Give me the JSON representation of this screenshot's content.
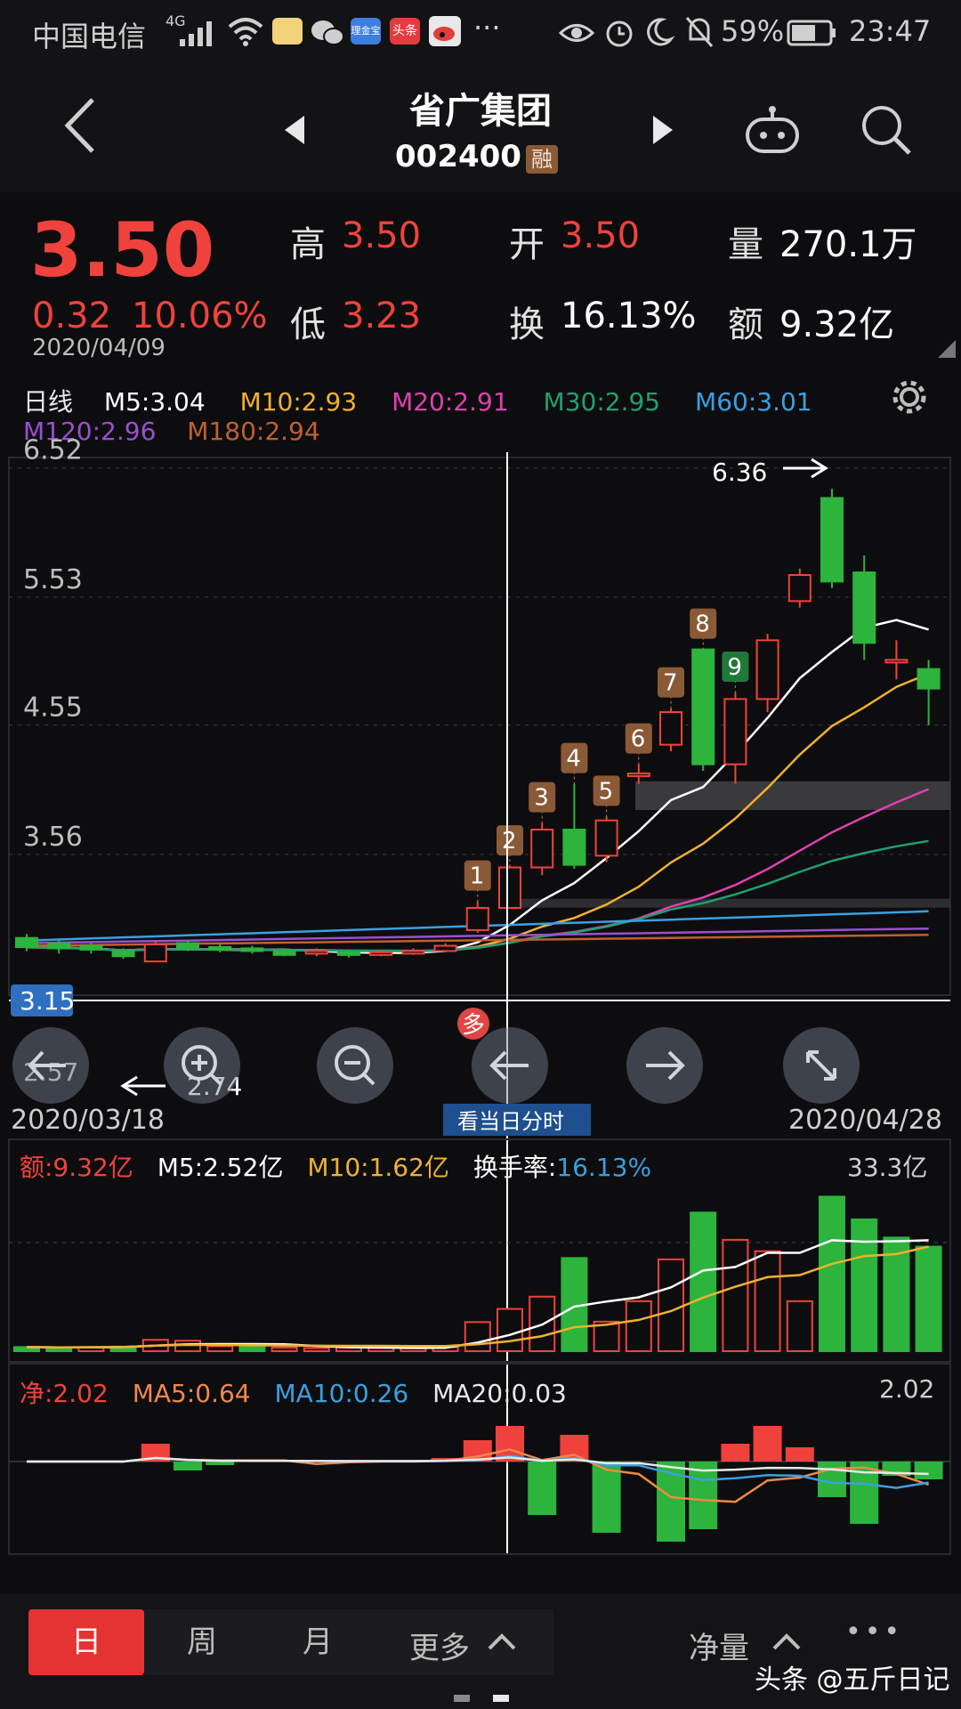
{
  "status_bar": {
    "carrier": "中国电信",
    "signal": "4G",
    "battery": "59%",
    "time": "23:47",
    "app_icons": [
      "game-app-icon",
      "wechat-icon",
      "jinyinbao-app-icon",
      "toutiao-app-icon",
      "weibo-icon"
    ],
    "app_icon_labels": [
      "",
      "",
      "理金宝",
      "头条",
      ""
    ],
    "more": "···"
  },
  "header": {
    "stock_name": "省广集团",
    "stock_code": "002400",
    "margin_badge": "融"
  },
  "quote": {
    "price": "3.50",
    "change": "0.32",
    "change_pct": "10.06%",
    "date": "2020/04/09",
    "high_label": "高",
    "high": "3.50",
    "low_label": "低",
    "low": "3.23",
    "open_label": "开",
    "open": "3.50",
    "turnover_label": "换",
    "turnover": "16.13%",
    "volume_label": "量",
    "volume": "270.1万",
    "amount_label": "额",
    "amount": "9.32亿"
  },
  "ma_legend": {
    "period": "日线",
    "m5": "M5:3.04",
    "m10": "M10:2.93",
    "m20": "M20:2.91",
    "m30": "M30:2.95",
    "m60": "M60:3.01",
    "m120": "M120:2.96",
    "m180": "M180:2.94",
    "colors": {
      "m5": "#ffffff",
      "m10": "#f0b030",
      "m20": "#e040b0",
      "m30": "#20a070",
      "m60": "#3aa0e0",
      "m120": "#9a50d0",
      "m180": "#c06030"
    }
  },
  "chart_data": {
    "type": "candlestick",
    "y_ticks": [
      "6.52",
      "5.53",
      "4.55",
      "3.56"
    ],
    "ylim": [
      2.55,
      6.6
    ],
    "crosshair_value": "3.15",
    "max_annotation": "6.36",
    "min_annotation": "2.74",
    "left_edge_value": "2.57",
    "start_date": "2020/03/18",
    "end_date": "2020/04/28",
    "view_intraday_label": "看当日分时",
    "signal_marker": "多",
    "count_labels": [
      "1",
      "2",
      "3",
      "4",
      "5",
      "6",
      "7",
      "8",
      "9"
    ],
    "candles": [
      {
        "o": 2.92,
        "c": 2.85,
        "h": 2.95,
        "l": 2.82
      },
      {
        "o": 2.88,
        "c": 2.84,
        "h": 2.9,
        "l": 2.8
      },
      {
        "o": 2.86,
        "c": 2.83,
        "h": 2.88,
        "l": 2.8
      },
      {
        "o": 2.82,
        "c": 2.78,
        "h": 2.84,
        "l": 2.76
      },
      {
        "o": 2.74,
        "c": 2.87,
        "h": 2.9,
        "l": 2.74
      },
      {
        "o": 2.88,
        "c": 2.84,
        "h": 2.9,
        "l": 2.82
      },
      {
        "o": 2.85,
        "c": 2.83,
        "h": 2.87,
        "l": 2.81
      },
      {
        "o": 2.84,
        "c": 2.82,
        "h": 2.86,
        "l": 2.8
      },
      {
        "o": 2.82,
        "c": 2.79,
        "h": 2.84,
        "l": 2.78
      },
      {
        "o": 2.8,
        "c": 2.82,
        "h": 2.84,
        "l": 2.78
      },
      {
        "o": 2.81,
        "c": 2.79,
        "h": 2.83,
        "l": 2.77
      },
      {
        "o": 2.79,
        "c": 2.81,
        "h": 2.83,
        "l": 2.78
      },
      {
        "o": 2.8,
        "c": 2.82,
        "h": 2.84,
        "l": 2.79
      },
      {
        "o": 2.82,
        "c": 2.86,
        "h": 2.88,
        "l": 2.81
      },
      {
        "o": 2.98,
        "c": 3.15,
        "h": 3.2,
        "l": 2.96
      },
      {
        "o": 3.15,
        "c": 3.46,
        "h": 3.47,
        "l": 3.15
      },
      {
        "o": 3.46,
        "c": 3.75,
        "h": 3.8,
        "l": 3.4
      },
      {
        "o": 3.75,
        "c": 3.48,
        "h": 4.1,
        "l": 3.45
      },
      {
        "o": 3.55,
        "c": 3.82,
        "h": 3.85,
        "l": 3.5
      },
      {
        "o": 4.18,
        "c": 4.18,
        "h": 4.25,
        "l": 4.1
      },
      {
        "o": 4.4,
        "c": 4.65,
        "h": 4.68,
        "l": 4.35
      },
      {
        "o": 5.13,
        "c": 4.25,
        "h": 5.13,
        "l": 4.2
      },
      {
        "o": 4.25,
        "c": 4.75,
        "h": 4.8,
        "l": 4.1
      },
      {
        "o": 4.75,
        "c": 5.2,
        "h": 5.25,
        "l": 4.65
      },
      {
        "o": 5.5,
        "c": 5.7,
        "h": 5.75,
        "l": 5.45
      },
      {
        "o": 6.29,
        "c": 5.65,
        "h": 6.36,
        "l": 5.6
      },
      {
        "o": 5.72,
        "c": 5.18,
        "h": 5.85,
        "l": 5.05
      },
      {
        "o": 5.05,
        "c": 5.05,
        "h": 5.2,
        "l": 4.9
      },
      {
        "o": 4.98,
        "c": 4.83,
        "h": 5.05,
        "l": 4.55
      }
    ],
    "resistance_zone": [
      4.12,
      3.9
    ],
    "volume": {
      "legend_amount": "额:9.32亿",
      "legend_m5": "M5:2.52亿",
      "legend_m10": "M10:1.62亿",
      "legend_turnover_label": "换手率:",
      "legend_turnover": "16.13%",
      "max_label": "33.3亿",
      "ylim": [
        0,
        33.3
      ],
      "values": [
        0.9,
        0.8,
        0.9,
        1.0,
        2.5,
        2.3,
        1.1,
        0.9,
        0.8,
        0.7,
        0.8,
        0.7,
        0.6,
        0.9,
        6.4,
        9.3,
        12.0,
        20.5,
        6.5,
        11.0,
        20.2,
        30.5,
        24.5,
        22.0,
        11.0,
        34.0,
        29.0,
        25.0,
        23.0
      ],
      "up": [
        false,
        false,
        true,
        false,
        true,
        true,
        true,
        false,
        true,
        true,
        true,
        true,
        true,
        true,
        true,
        true,
        true,
        false,
        true,
        true,
        true,
        false,
        true,
        true,
        true,
        false,
        false,
        false,
        false
      ]
    },
    "flow": {
      "legend_net": "净:2.02",
      "legend_ma5": "MA5:0.64",
      "legend_ma10": "MA10:0.26",
      "legend_ma20": "MA20:0.03",
      "max_label": "2.02",
      "values": [
        0,
        0,
        0,
        0,
        1.0,
        -0.5,
        -0.2,
        0,
        0,
        0,
        0,
        0,
        0,
        0.2,
        1.2,
        2.0,
        -3.0,
        1.5,
        -4.0,
        0,
        -4.5,
        -3.8,
        1.0,
        2.0,
        0.8,
        -2.0,
        -3.5,
        -0.8,
        -1.0
      ]
    }
  },
  "overlay_buttons": {
    "scroll_left": "scroll-left-icon",
    "zoom_in": "zoom-in-icon",
    "zoom_out": "zoom-out-icon",
    "pan_left": "arrow-left-icon",
    "pan_right": "arrow-right-icon",
    "fullscreen": "fullscreen-icon"
  },
  "bottom_tabs": {
    "day": "日",
    "week": "周",
    "month": "月",
    "more": "更多",
    "indicator": "净量",
    "menu": "•••"
  },
  "watermark": "头条 @五斤日记"
}
